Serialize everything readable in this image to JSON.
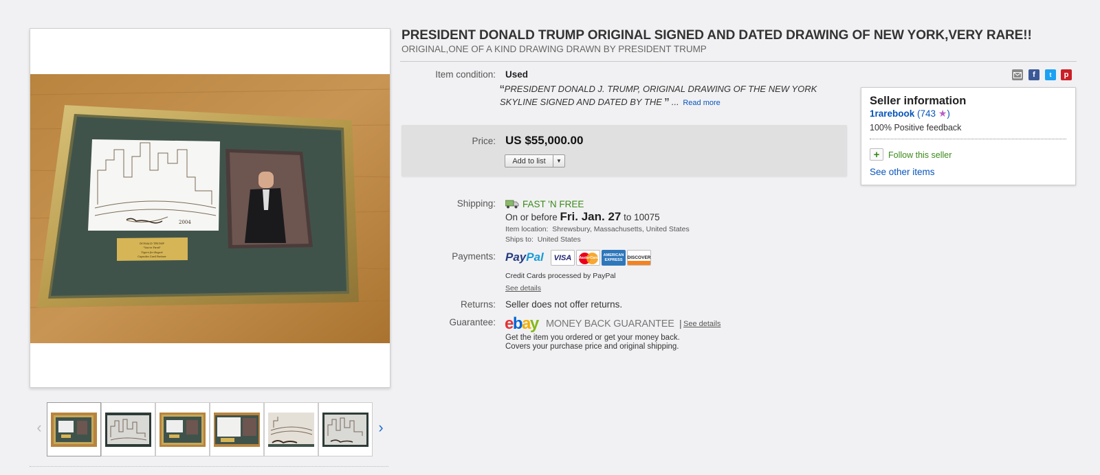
{
  "listing": {
    "title": "PRESIDENT DONALD TRUMP ORIGINAL SIGNED AND DATED DRAWING OF NEW YORK,VERY RARE!!",
    "subtitle": "ORIGINAL,ONE OF A KIND DRAWING DRAWN BY PRESIDENT TRUMP"
  },
  "gallery": {
    "thumbnails": [
      "thumbnail-1",
      "thumbnail-2",
      "thumbnail-3",
      "thumbnail-4",
      "thumbnail-5",
      "thumbnail-6"
    ],
    "prev_icon": "chevron-left-icon",
    "next_icon": "chevron-right-icon",
    "plaque_line1": "DONALD TRUMP",
    "plaque_line2": "\"You're Fired\"",
    "plaque_line3": "Tigers for Bogart",
    "plaque_line4": "Capsules Card Partner",
    "signature_date": "2004"
  },
  "details": {
    "condition_label": "Item condition:",
    "condition_value": "Used",
    "quote_open": "“",
    "quote_text": "PRESIDENT DONALD J. TRUMP, ORIGINAL DRAWING OF THE NEW YORK SKYLINE SIGNED AND DATED BY THE",
    "quote_close": "”",
    "quote_ellipsis": " ...",
    "read_more": "Read more",
    "price_label": "Price:",
    "price_value": "US $55,000.00",
    "add_to_list": "Add to list",
    "shipping_label": "Shipping:",
    "shipping_fast": "FAST 'N FREE",
    "shipping_before": "On or before ",
    "shipping_date": "Fri. Jan. 27",
    "shipping_to": " to 10075",
    "item_location_label": "Item location:",
    "item_location_value": "Shrewsbury, Massachusetts, United States",
    "ships_to_label": "Ships to:",
    "ships_to_value": "United States",
    "payments_label": "Payments:",
    "paypal_pay": "Pay",
    "paypal_pal": "Pal",
    "card_visa": "VISA",
    "card_mastercard": "MasterCard",
    "card_amex_1": "AMERICAN",
    "card_amex_2": "EXPRESS",
    "card_discover": "DISCOVER",
    "payments_note": "Credit Cards processed by PayPal",
    "payments_details": "See details",
    "returns_label": "Returns:",
    "returns_value": "Seller does not offer returns.",
    "guarantee_label": "Guarantee:",
    "ebay_e": "e",
    "ebay_b": "b",
    "ebay_a": "a",
    "ebay_y": "y",
    "mbg_text": "MONEY BACK GUARANTEE",
    "mbg_sep": "|",
    "mbg_details": "See details",
    "guarantee_line1": "Get the item you ordered or get your money back.",
    "guarantee_line2": "Covers your purchase price and original shipping."
  },
  "share": {
    "email_icon": "email-icon",
    "facebook_glyph": "f",
    "twitter_glyph": "t",
    "pinterest_glyph": "p"
  },
  "seller": {
    "heading": "Seller information",
    "name": "1rarebook",
    "feedback_open": " (743 ",
    "star": "★",
    "feedback_close": ")",
    "positive": "100% Positive feedback",
    "follow_plus": "+",
    "follow": "Follow this seller",
    "other_items": "See other items"
  },
  "colors": {
    "link_blue": "#0654ba",
    "green": "#3a8a1a",
    "price_box": "#e0e0e0"
  }
}
